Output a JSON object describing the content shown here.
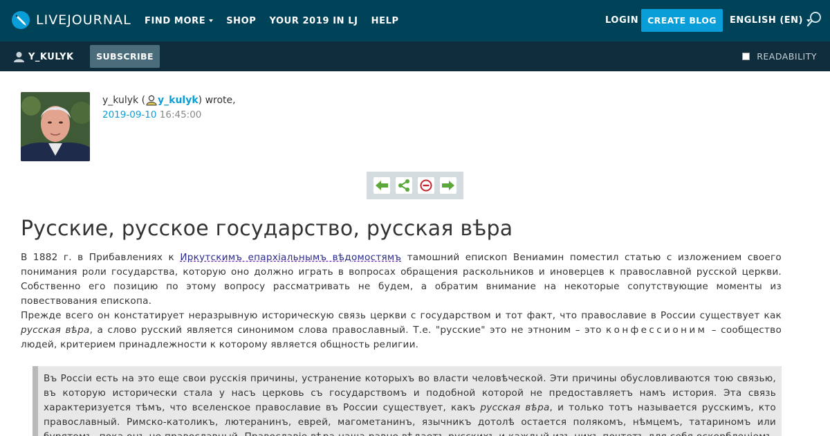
{
  "header": {
    "logo_text": "LIVEJOURNAL",
    "nav": {
      "find_more": "FIND MORE",
      "shop": "SHOP",
      "your_year": "YOUR 2019 IN LJ",
      "help": "HELP"
    },
    "login": "LOGIN",
    "create_blog": "CREATE BLOG",
    "language": "ENGLISH (EN)",
    "search_icon": "search-icon",
    "colors": {
      "bar": "#004359",
      "accent": "#0a9ed8"
    }
  },
  "subheader": {
    "username": "Y_KULYK",
    "subscribe": "SUBSCRIBE",
    "readability": "READABILITY",
    "colors": {
      "bar": "#0f2d3d"
    }
  },
  "entry": {
    "author_plain": "y_kulyk (",
    "author_link": "y_kulyk",
    "wrote": ") wrote,",
    "date": "2019-09-10",
    "time": "16:45:00",
    "controls": [
      "previous-arrow-icon",
      "share-icon",
      "remove-icon",
      "next-arrow-icon"
    ]
  },
  "article": {
    "title": "Русские, русское государство, русская вѣра",
    "p1_start": "В 1882 г. в Прибавлениях к ",
    "p1_link": "Иркутскимъ епархіальнымъ вѣдомостямъ",
    "p1_rest": " тамошний епископ Вениамин поместил статью с изложением своего понимания роли государства, которую оно должно играть в вопросах обращения раскольников и иноверцев к православной русской церкви. Собственно его позицию по этому вопросу рассматривать не будем, а обратим внимание на некоторые сопутствующие моменты из повествования епископа.",
    "p2_start": "Прежде всего он констатирует неразрывную историческую связь церкви с государством и тот факт, что православие в России существует как ",
    "p2_italic": "русская вѣра",
    "p2_mid": ", а слово русский является синонимом слова православный. Т.е. \"русские\" это не этноним – это ",
    "p2_spaced": "конфессионим",
    "p2_end": " – сообщество людей, критерием принадлежности к которому является общность религии.",
    "quote_start": "Въ Россіи есть на это еще свои русскія причины, устранение которыхъ во власти человѣческой. Эти причины обусловливаются тою связью, въ которую исторически стала у насъ церковь съ государствомъ и подобной которой не предоставляетъ намъ история. Эта связь характеризуется тѣмъ, что вселенское православие въ России существует, какъ ",
    "quote_italic": "русская вѣра",
    "quote_rest": ", и только тотъ называется русскимъ, кто православный. Римско-католикъ, лютеранинъ, еврей, магометанинъ, язычникъ дотолѣ остается полякомъ, нѣмцемъ, татариномъ или бурятомъ, пока онъ не православный. Православіе вѣра наша равно вѣдаетъ русскихъ и каждый изъ нихъ почтетъ для себя оскорбленіемъ, если не признать православіе его народной..."
  }
}
